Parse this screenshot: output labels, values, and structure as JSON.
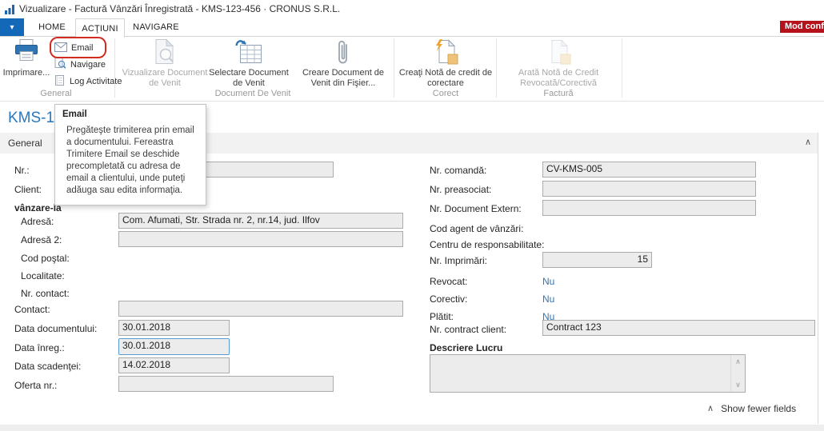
{
  "colors": {
    "accent_blue": "#1368b8",
    "annotation_red": "#d22b1f",
    "badge_bg": "#b5121b",
    "field_bg": "#ececec",
    "field_border": "#ababab"
  },
  "window": {
    "title": "Vizualizare - Factură Vânzări Înregistrată - KMS-123-456 · CRONUS S.R.L."
  },
  "tab_bar": {
    "tabs": [
      {
        "label": "HOME"
      },
      {
        "label": "ACŢIUNI"
      },
      {
        "label": "NAVIGARE"
      }
    ],
    "badge": "Mod configurare"
  },
  "ribbon": {
    "imprimare": "Imprimare...",
    "email": "Email",
    "navigare": "Navigare",
    "log_activitate": "Log Activitate",
    "vizualizare_doc": "Vizualizare Document de Venit",
    "selectare_doc": "Selectare Document de Venit",
    "creare_doc": "Creare Document de Venit din Fişier...",
    "creati_nota": "Creaţi Notă de credit de corectare",
    "arata_nota": "Arată Notă de Credit Revocată/Corectivă",
    "groups": {
      "general": "General",
      "document": "Document De Venit",
      "corect": "Corect",
      "factura": "Factură"
    }
  },
  "tooltip": {
    "title": "Email",
    "body": "Pregăteşte trimiterea prin email a documentului. Fereastra Trimitere Email se deschide precompletată cu adresa de email a clientului, unde puteţi adăuga sau edita informaţia."
  },
  "page": {
    "title": "KMS-12",
    "section": "General",
    "show_fewer": "Show fewer fields",
    "collapse_chevron": "∧"
  },
  "fields": {
    "left": {
      "nr": {
        "label": "Nr.:",
        "value": ""
      },
      "client": {
        "label": "Client:",
        "value": ""
      },
      "vanzare_la": {
        "label": "vânzare-la"
      },
      "adresa": {
        "label": "Adresă:",
        "value": "Com. Afumati, Str. Strada nr. 2, nr.14, jud. Ilfov"
      },
      "adresa2": {
        "label": "Adresă 2:",
        "value": ""
      },
      "cod_postal": {
        "label": "Cod poştal:"
      },
      "localitate": {
        "label": "Localitate:"
      },
      "nr_contact": {
        "label": "Nr. contact:"
      },
      "contact": {
        "label": "Contact:",
        "value": ""
      },
      "data_doc": {
        "label": "Data documentului:",
        "value": "30.01.2018"
      },
      "data_inreg": {
        "label": "Data înreg.:",
        "value": "30.01.2018"
      },
      "data_scad": {
        "label": "Data scadenţei:",
        "value": "14.02.2018"
      },
      "oferta": {
        "label": "Oferta nr.:",
        "value": ""
      }
    },
    "right": {
      "nr_comanda": {
        "label": "Nr. comandă:",
        "value": "CV-KMS-005"
      },
      "nr_preasociat": {
        "label": "Nr. preasociat:",
        "value": ""
      },
      "nr_doc_extern": {
        "label": "Nr. Document Extern:",
        "value": ""
      },
      "cod_agent": {
        "label": "Cod agent de vânzări:"
      },
      "centru_resp": {
        "label": "Centru de responsabilitate:"
      },
      "nr_imprimari": {
        "label": "Nr. Imprimări:",
        "value": "15"
      },
      "revocat": {
        "label": "Revocat:",
        "value": "Nu"
      },
      "corectiv": {
        "label": "Corectiv:",
        "value": "Nu"
      },
      "platit": {
        "label": "Plătit:",
        "value": "Nu"
      },
      "nr_contract": {
        "label": "Nr. contract client:",
        "value": "Contract 123"
      },
      "descriere": {
        "label": "Descriere Lucru",
        "value": ""
      }
    }
  }
}
